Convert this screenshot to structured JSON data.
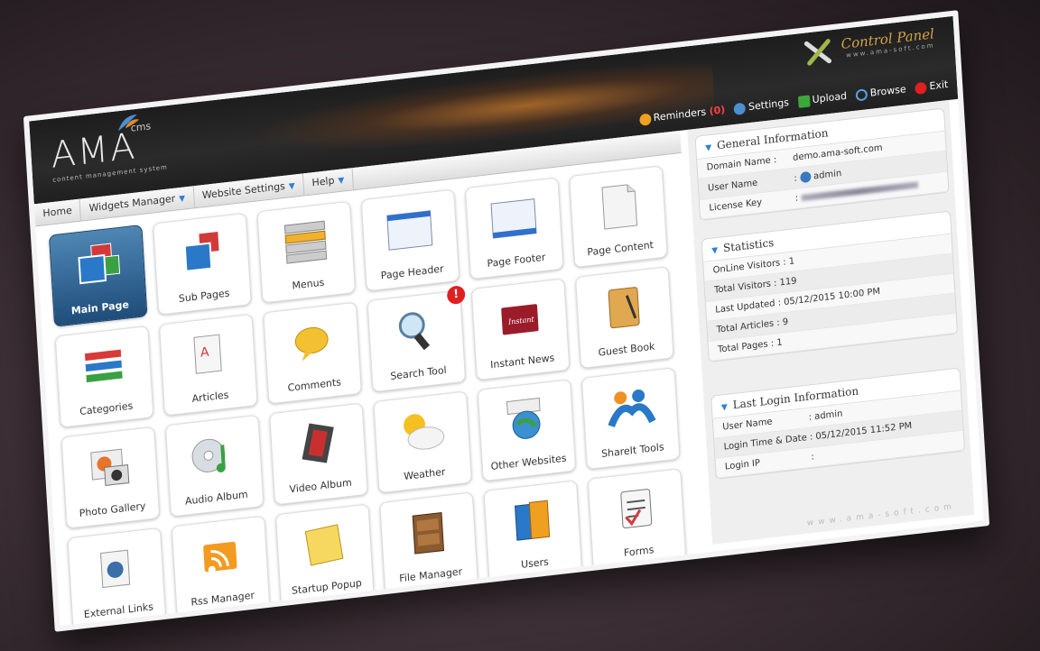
{
  "header": {
    "logo_word": "AMA",
    "logo_cms": "cms",
    "logo_tagline": "content management system",
    "control_panel": "Control Panel",
    "site": "www.ama-soft.com"
  },
  "topbar": {
    "reminders": "Reminders",
    "reminders_count": "(0)",
    "settings": "Settings",
    "upload": "Upload",
    "browse": "Browse",
    "exit": "Exit"
  },
  "nav": [
    "Home",
    "Widgets Manager",
    "Website Settings",
    "Help"
  ],
  "tiles": [
    {
      "label": "Main Page",
      "icon": "windows-stack-icon"
    },
    {
      "label": "Sub Pages",
      "icon": "windows-stack-icon"
    },
    {
      "label": "Menus",
      "icon": "menu-list-icon"
    },
    {
      "label": "Page Header",
      "icon": "window-header-icon"
    },
    {
      "label": "Page Footer",
      "icon": "window-footer-icon"
    },
    {
      "label": "Page Content",
      "icon": "document-icon"
    },
    {
      "label": "Categories",
      "icon": "categories-icon"
    },
    {
      "label": "Articles",
      "icon": "article-icon"
    },
    {
      "label": "Comments",
      "icon": "comment-bubble-icon"
    },
    {
      "label": "Search Tool",
      "icon": "magnifier-icon"
    },
    {
      "label": "Instant News",
      "icon": "news-icon"
    },
    {
      "label": "Guest Book",
      "icon": "guest-book-icon"
    },
    {
      "label": "Photo Gallery",
      "icon": "photo-gallery-icon"
    },
    {
      "label": "Audio Album",
      "icon": "audio-cd-icon"
    },
    {
      "label": "Video Album",
      "icon": "video-film-icon"
    },
    {
      "label": "Weather",
      "icon": "weather-icon"
    },
    {
      "label": "Other Websites",
      "icon": "globe-www-icon"
    },
    {
      "label": "ShareIt Tools",
      "icon": "share-people-icon"
    },
    {
      "label": "External Links",
      "icon": "external-link-icon"
    },
    {
      "label": "Rss Manager",
      "icon": "rss-icon"
    },
    {
      "label": "Startup Popup",
      "icon": "notes-icon"
    },
    {
      "label": "File Manager",
      "icon": "file-cabinet-icon"
    },
    {
      "label": "Users",
      "icon": "users-icon"
    },
    {
      "label": "Forms",
      "icon": "form-icon"
    }
  ],
  "search_badge": "!",
  "instant_label": "Instant",
  "general": {
    "title": "General Information",
    "domain_k": "Domain Name :",
    "domain_v": "demo.ama-soft.com",
    "user_k": "User Name",
    "user_sep": ":",
    "user_v": "admin",
    "license_k": "License Key",
    "license_sep": ":"
  },
  "stats": {
    "title": "Statistics",
    "rows": [
      {
        "k": "OnLine Visitors : 1"
      },
      {
        "k": "Total Visitors    : 119"
      },
      {
        "k": "Last Updated    : 05/12/2015 10:00 PM"
      },
      {
        "k": "Total Articles    : 9"
      },
      {
        "k": "Total Pages       : 1"
      }
    ]
  },
  "last_login": {
    "title": "Last Login Information",
    "user_k": "User Name",
    "user_v": ": admin",
    "time_k": "Login Time & Date :",
    "time_v": "05/12/2015 11:52 PM",
    "ip_k": "Login IP",
    "ip_v": ":"
  },
  "footer_site": "www.ama-soft.com",
  "colors": {
    "accent": "#2f7fd8",
    "header": "#1d1d1d",
    "active_tile": "#1f4d7a",
    "alert": "#e02020"
  }
}
